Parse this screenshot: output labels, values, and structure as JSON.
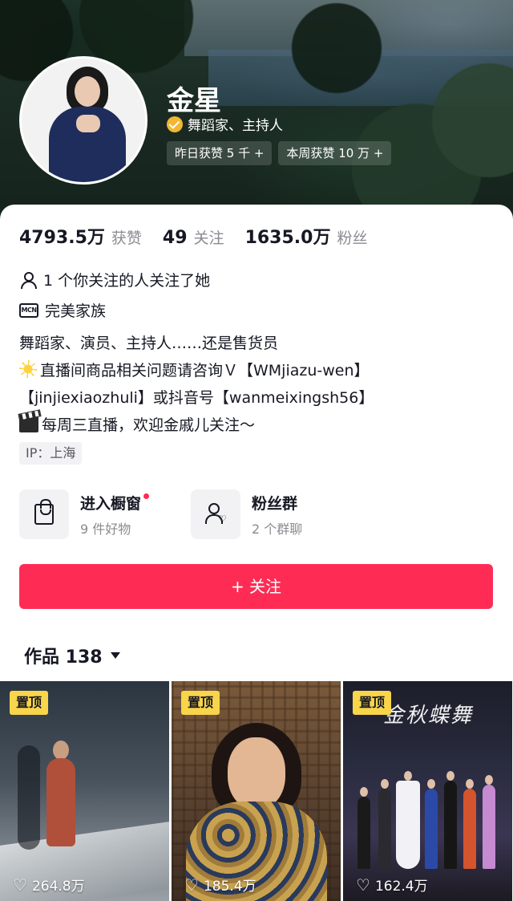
{
  "profile": {
    "name": "金星",
    "verified_label": "舞蹈家、主持人",
    "pills": [
      "昨日获赞 5 千 +",
      "本周获赞 10 万 +"
    ]
  },
  "stats": [
    {
      "value": "4793.5万",
      "label": "获赞"
    },
    {
      "value": "49",
      "label": "关注"
    },
    {
      "value": "1635.0万",
      "label": "粉丝"
    }
  ],
  "mutual": "1 个你关注的人关注了她",
  "mcn": {
    "icon_text": "MCN",
    "label": "完美家族"
  },
  "bio": {
    "line1": "舞蹈家、演员、主持人……还是售货员",
    "line2": "直播间商品相关问题请咨询Ｖ【WMjiazu-wen】",
    "line3": "【jinjiexiaozhuli】或抖音号【wanmeixingsh56】",
    "line4": "每周三直播，欢迎金戚儿关注～"
  },
  "ip": "IP：上海",
  "features": {
    "shop": {
      "title": "进入橱窗",
      "sub": "9 件好物"
    },
    "fans": {
      "title": "粉丝群",
      "sub": "2 个群聊"
    }
  },
  "follow_button": "+ 关注",
  "works": {
    "label": "作品 138"
  },
  "videos": [
    {
      "pin": "置顶",
      "likes": "264.8万"
    },
    {
      "pin": "置顶",
      "likes": "185.4万"
    },
    {
      "pin": "置顶",
      "likes": "162.4万",
      "overlay_title": "金秋蝶舞"
    }
  ],
  "colors": {
    "accent": "#fe2c55",
    "pin_badge": "#f8d54a",
    "verified_badge": "#f2b731"
  },
  "icons": [
    "person-icon",
    "mcn-icon",
    "star-emoji-icon",
    "clapperboard-icon",
    "shopping-bag-icon",
    "fans-group-icon",
    "heart-icon",
    "caret-down-icon",
    "verified-icon"
  ]
}
